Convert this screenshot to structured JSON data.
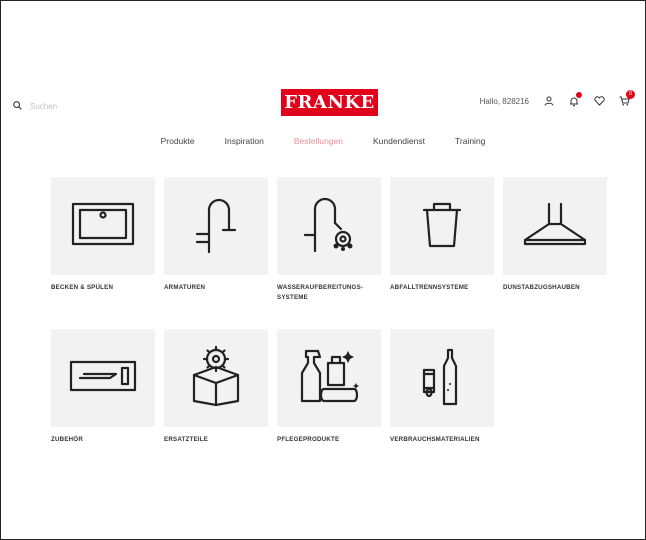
{
  "header": {
    "search_placeholder": "Suchen",
    "logo_text": "FRANKE",
    "greeting": "Hallo, 828216",
    "cart_count": "0"
  },
  "nav": {
    "items": [
      "Produkte",
      "Inspiration",
      "Bestellungen",
      "Kundendienst",
      "Training"
    ],
    "active_index": 2
  },
  "categories": [
    {
      "label": "BECKEN & SPÜLEN",
      "icon": "sink-icon"
    },
    {
      "label": "ARMATUREN",
      "icon": "faucet-icon"
    },
    {
      "label": "WASSERAUFBEREITUNGS-SYSTEME",
      "icon": "water-tap-icon"
    },
    {
      "label": "ABFALLTRENNSYSTEME",
      "icon": "waste-bin-icon"
    },
    {
      "label": "DUNSTABZUGSHAUBEN",
      "icon": "hood-icon"
    },
    {
      "label": "ZUBEHÖR",
      "icon": "cutting-board-icon"
    },
    {
      "label": "ERSATZTEILE",
      "icon": "spare-parts-icon"
    },
    {
      "label": "PFLEGEPRODUKTE",
      "icon": "care-products-icon"
    },
    {
      "label": "VERBRAUCHSMATERIALIEN",
      "icon": "consumables-icon"
    }
  ],
  "colors": {
    "brand": "#e2001a",
    "tile_bg": "#f2f2f2"
  }
}
